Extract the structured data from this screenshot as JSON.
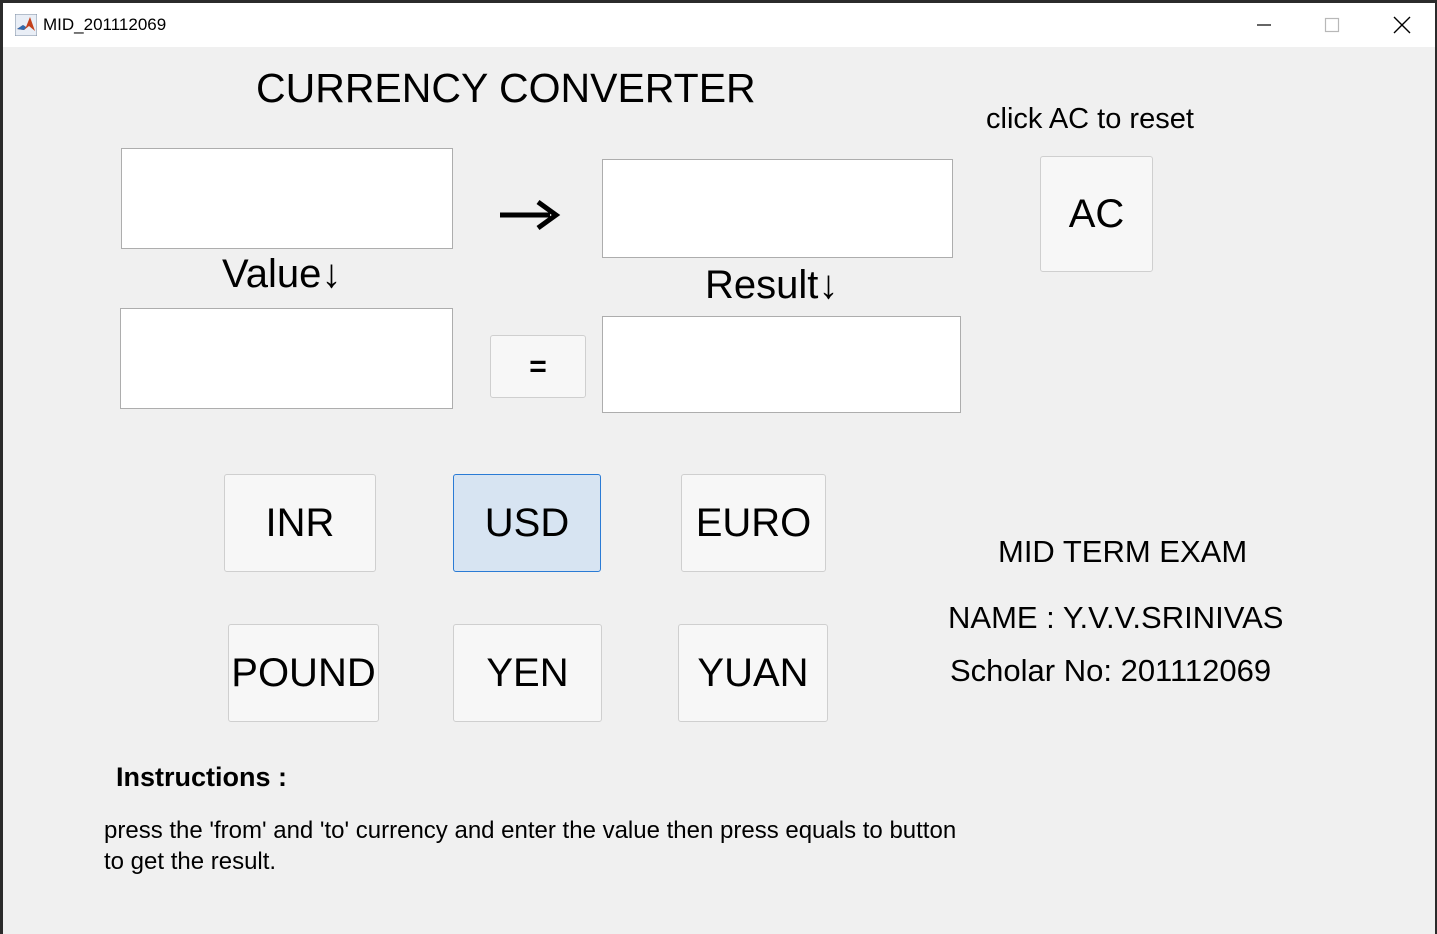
{
  "window": {
    "title": "MID_201112069"
  },
  "app": {
    "heading": "CURRENCY CONVERTER",
    "reset_hint": "click AC to reset",
    "ac_label": "AC",
    "from_value": "",
    "to_value": "",
    "value_label": "Value↓",
    "result_label": "Result↓",
    "value_input": "",
    "result_output": "",
    "arrow_symbol": "→",
    "equals_label": "=",
    "currencies": [
      "INR",
      "USD",
      "EURO",
      "POUND",
      "YEN",
      "YUAN"
    ],
    "selected_currency": "USD",
    "exam_title": "MID TERM EXAM",
    "name_line": "NAME : Y.V.V.SRINIVAS",
    "scholar_line": "Scholar No: 201112069",
    "instructions_heading": "Instructions :",
    "instructions_line1": "press the 'from' and 'to' currency and enter the value then press equals to button",
    "instructions_line2": "to get the result."
  },
  "colors": {
    "selected_bg": "#d7e4f2",
    "selected_border": "#2a7bd5",
    "panel_bg": "#f0f0f0"
  },
  "icons": [
    "matlab-icon",
    "minimize-icon",
    "maximize-icon",
    "close-icon",
    "arrow-right-icon"
  ]
}
